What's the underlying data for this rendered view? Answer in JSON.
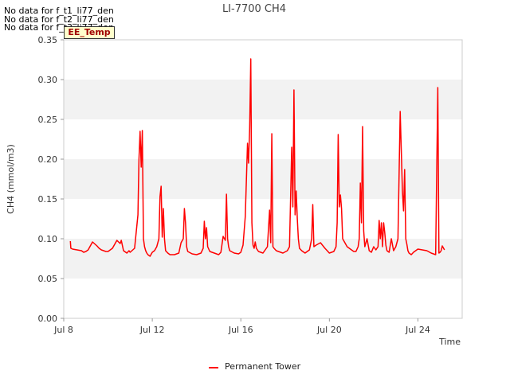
{
  "no_data_messages": [
    "No data for f_t1_li77_den",
    "No data for f_t2_li77_den",
    "No data for f_t3_li77_den"
  ],
  "badge_label": "EE_Temp",
  "chart_data": {
    "type": "line",
    "title": "LI-7700 CH4",
    "xlabel": "Time",
    "ylabel": "CH4 (mmol/m3)",
    "ylim": [
      0.0,
      0.35
    ],
    "y_ticks": [
      "0.00",
      "0.05",
      "0.10",
      "0.15",
      "0.20",
      "0.25",
      "0.30",
      "0.35"
    ],
    "x_ticks": [
      {
        "label": "Jul 8",
        "day": 8
      },
      {
        "label": "Jul 12",
        "day": 12
      },
      {
        "label": "Jul 16",
        "day": 16
      },
      {
        "label": "Jul 20",
        "day": 20
      },
      {
        "label": "Jul 24",
        "day": 24
      }
    ],
    "xlim_days": [
      8.0,
      26.0
    ],
    "grid": "alternating horizontal bands",
    "legend_position": "bottom-center",
    "series": [
      {
        "name": "Permanent Tower",
        "color": "#ff0000",
        "x_days": [
          8.3,
          8.32,
          8.4,
          8.6,
          8.8,
          8.9,
          9.0,
          9.1,
          9.3,
          9.5,
          9.6,
          9.7,
          9.9,
          10.0,
          10.2,
          10.4,
          10.55,
          10.6,
          10.7,
          10.85,
          10.95,
          11.0,
          11.2,
          11.35,
          11.4,
          11.45,
          11.5,
          11.55,
          11.6,
          11.65,
          11.7,
          11.75,
          11.8,
          11.9,
          12.0,
          12.1,
          12.2,
          12.3,
          12.35,
          12.4,
          12.45,
          12.5,
          12.55,
          12.6,
          12.7,
          12.8,
          13.0,
          13.2,
          13.3,
          13.4,
          13.45,
          13.5,
          13.55,
          13.6,
          13.8,
          14.0,
          14.2,
          14.3,
          14.35,
          14.4,
          14.45,
          14.5,
          14.6,
          14.8,
          15.0,
          15.1,
          15.2,
          15.3,
          15.35,
          15.4,
          15.45,
          15.5,
          15.7,
          15.9,
          16.0,
          16.1,
          16.2,
          16.3,
          16.35,
          16.4,
          16.45,
          16.5,
          16.55,
          16.6,
          16.65,
          16.7,
          16.8,
          17.0,
          17.2,
          17.3,
          17.35,
          17.4,
          17.45,
          17.5,
          17.6,
          17.7,
          17.9,
          18.1,
          18.2,
          18.3,
          18.35,
          18.4,
          18.45,
          18.5,
          18.55,
          18.6,
          18.65,
          18.75,
          18.9,
          19.1,
          19.2,
          19.25,
          19.3,
          19.4,
          19.6,
          19.8,
          19.9,
          20.0,
          20.2,
          20.3,
          20.35,
          20.4,
          20.45,
          20.5,
          20.55,
          20.6,
          20.8,
          21.0,
          21.1,
          21.2,
          21.3,
          21.35,
          21.4,
          21.45,
          21.5,
          21.55,
          21.6,
          21.7,
          21.8,
          21.9,
          22.0,
          22.1,
          22.2,
          22.25,
          22.3,
          22.35,
          22.4,
          22.45,
          22.5,
          22.55,
          22.6,
          22.7,
          22.8,
          22.9,
          23.0,
          23.1,
          23.2,
          23.3,
          23.35,
          23.4,
          23.45,
          23.5,
          23.55,
          23.6,
          23.7,
          23.8,
          24.0,
          24.2,
          24.4,
          24.6,
          24.8,
          24.9,
          24.95,
          25.0,
          25.05,
          25.1,
          25.2,
          25.3,
          25.35,
          25.4
        ],
        "y": [
          0.097,
          0.088,
          0.087,
          0.086,
          0.085,
          0.083,
          0.084,
          0.086,
          0.096,
          0.091,
          0.088,
          0.086,
          0.084,
          0.084,
          0.088,
          0.098,
          0.094,
          0.098,
          0.085,
          0.082,
          0.085,
          0.083,
          0.088,
          0.13,
          0.2,
          0.235,
          0.19,
          0.236,
          0.1,
          0.09,
          0.085,
          0.082,
          0.08,
          0.078,
          0.083,
          0.085,
          0.09,
          0.1,
          0.153,
          0.166,
          0.102,
          0.138,
          0.1,
          0.085,
          0.082,
          0.08,
          0.08,
          0.082,
          0.095,
          0.1,
          0.138,
          0.12,
          0.09,
          0.084,
          0.081,
          0.08,
          0.082,
          0.088,
          0.122,
          0.1,
          0.114,
          0.09,
          0.084,
          0.082,
          0.08,
          0.083,
          0.103,
          0.098,
          0.156,
          0.1,
          0.09,
          0.085,
          0.082,
          0.081,
          0.083,
          0.092,
          0.128,
          0.22,
          0.195,
          0.238,
          0.326,
          0.12,
          0.092,
          0.088,
          0.096,
          0.088,
          0.084,
          0.082,
          0.09,
          0.136,
          0.095,
          0.232,
          0.09,
          0.088,
          0.085,
          0.084,
          0.082,
          0.085,
          0.09,
          0.215,
          0.14,
          0.287,
          0.13,
          0.16,
          0.125,
          0.1,
          0.088,
          0.085,
          0.082,
          0.086,
          0.1,
          0.143,
          0.09,
          0.092,
          0.095,
          0.088,
          0.085,
          0.082,
          0.084,
          0.09,
          0.12,
          0.231,
          0.14,
          0.155,
          0.138,
          0.1,
          0.09,
          0.086,
          0.084,
          0.084,
          0.09,
          0.1,
          0.17,
          0.12,
          0.241,
          0.11,
          0.09,
          0.1,
          0.085,
          0.083,
          0.09,
          0.086,
          0.09,
          0.123,
          0.1,
          0.12,
          0.09,
          0.12,
          0.108,
          0.092,
          0.085,
          0.083,
          0.1,
          0.085,
          0.09,
          0.1,
          0.26,
          0.16,
          0.135,
          0.187,
          0.1,
          0.093,
          0.085,
          0.082,
          0.08,
          0.083,
          0.087,
          0.086,
          0.085,
          0.082,
          0.08,
          0.29,
          0.082,
          0.083,
          0.085,
          0.091,
          0.086
        ]
      }
    ]
  }
}
